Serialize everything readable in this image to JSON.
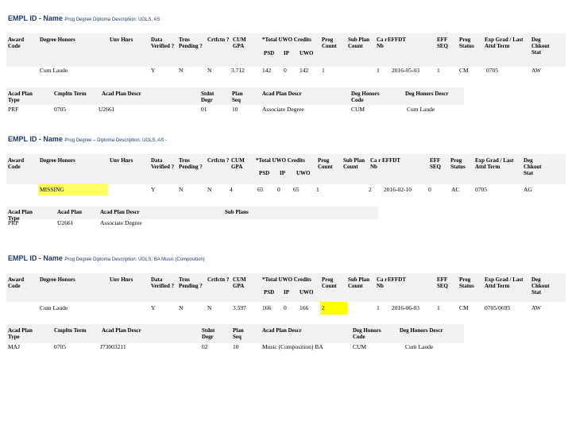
{
  "sections": [
    {
      "title_main": "EMPL ID - Name",
      "title_sub": "Prog Degree    Diploma Description: UGLS, AS",
      "degree_headers": [
        "Award Code",
        "Degree Honors",
        "Unv Hnrs",
        "Data Verified ?",
        "Trns Pending ?",
        "Crtfctn ?",
        "CUM GPA",
        "*Total UWO Credits",
        "Prog Count",
        "Sub Plan Count",
        "Ca r Nb",
        "EFFDT",
        "EFF SEQ",
        "Prog Status",
        "Exp Grad / Last Attd Term",
        "Deg Chkout Stat"
      ],
      "uwo_sub": [
        "PSD",
        "IP",
        "UWO"
      ],
      "degree_values": {
        "honors": "Cum Laude",
        "verified": "Y",
        "pending": "N",
        "crtfctn": "N",
        "gpa": "3.712",
        "psd": "142",
        "ip": "0",
        "uwo": "142",
        "prog_count": "1",
        "car_nbr": "1",
        "effdt": "2016-05-03",
        "eff_seq": "1",
        "prog_status": "CM",
        "exp_grad": "0705",
        "deg_chkout": "AW"
      },
      "plan_headers": [
        "Acad Plan Type",
        "Cmpltn Term",
        "Acad Plan Descr",
        "Stdnt Degr",
        "Plan Seq",
        "Acad Plan Descr",
        "Deg Honors Code",
        "Deg Honors Descr"
      ],
      "plan_values": [
        "PRF",
        "0705",
        "U2661",
        "01",
        "10",
        "Associate Degree",
        "CUM",
        "Cum Laude"
      ]
    },
    {
      "title_main": "EMPL ID - Name",
      "title_sub": "Prog Degree – Diploma Description: UGLS, AS -",
      "degree_headers": [
        "Award Code",
        "Degree Honors",
        "Unv Hnrs",
        "Data Verified ?",
        "Trns Pending ?",
        "Crtfctn ?",
        "CUM GPA",
        "*Total UWO Credits",
        "Prog Count",
        "Sub Plan Count",
        "Ca r Nb",
        "EFFDT",
        "EFF SEQ",
        "Prog Status",
        "Exp Grad / Last Attd Term",
        "Deg Chkout Stat"
      ],
      "uwo_sub": [
        "PSD",
        "IP",
        "UWO"
      ],
      "degree_values": {
        "honors": "MISSING",
        "verified": "Y",
        "pending": "N",
        "crtfctn": "N",
        "gpa": "4",
        "psd": "65",
        "ip": "0",
        "uwo": "65",
        "prog_count": "1",
        "car_nbr": "2",
        "effdt": "2016-02-10",
        "eff_seq": "0",
        "prog_status": "AC",
        "exp_grad": "0705",
        "deg_chkout": "AG"
      },
      "plan_headers": [
        "Acad Plan Type",
        "Acad Plan",
        "Acad Plan Descr",
        "Sub Plans"
      ],
      "plan_values": [
        "PRP",
        "U2661",
        "Associate Degree",
        ""
      ]
    },
    {
      "title_main": "EMPL ID - Name",
      "title_sub": "Prog Degree    Diploma Description: UGLS, BA   Music (Composition)",
      "degree_headers": [
        "Award Code",
        "Degree Honors",
        "Unv Hnrs",
        "Data Verified ?",
        "Trns Pending ?",
        "Crtfctn ?",
        "CUM GPA",
        "*Total UWO Credits",
        "Prog Count",
        "Sub Plan Count",
        "Ca r Nb",
        "EFFDT",
        "EFF SEQ",
        "Prog Status",
        "Exp Grad / Last Attd Term",
        "Deg Chkout Stat"
      ],
      "uwo_sub": [
        "PSD",
        "IP",
        "UWO"
      ],
      "degree_values": {
        "honors": "Cum Laude",
        "verified": "Y",
        "pending": "N",
        "crtfctn": "N",
        "gpa": "3.597",
        "psd": "166",
        "ip": "0",
        "uwo": "166",
        "prog_count": "2",
        "car_nbr": "1",
        "effdt": "2016-06-03",
        "eff_seq": "1",
        "prog_status": "CM",
        "exp_grad": "0705/0695",
        "deg_chkout": "AW"
      },
      "plan_headers": [
        "Acad Plan Type",
        "Cmpltn Term",
        "Acad Plan Descr",
        "Stdnt Degr",
        "Plan Seq",
        "Acad Plan Descr",
        "Deg Honors Code",
        "Deg Honors Descr"
      ],
      "plan_values": [
        "MAJ",
        "0705",
        "J73003211",
        "02",
        "10",
        "Music (Composition)   BA",
        "CUM",
        "Cum Laude"
      ]
    }
  ]
}
